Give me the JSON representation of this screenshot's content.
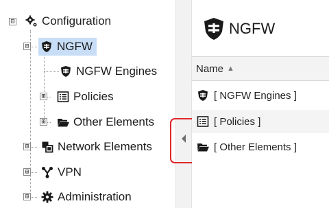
{
  "tree": {
    "root": {
      "label": "Configuration",
      "expander": "⊟",
      "icon": "gear-icon"
    },
    "items": [
      {
        "label": "NGFW",
        "expander": "⊟",
        "icon": "shield-icon",
        "selected": true
      },
      {
        "label": "NGFW Engines",
        "expander": "",
        "icon": "shield-icon"
      },
      {
        "label": "Policies",
        "expander": "⊞",
        "icon": "policy-list-icon"
      },
      {
        "label": "Other Elements",
        "expander": "⊞",
        "icon": "folder-icon"
      },
      {
        "label": "Network Elements",
        "expander": "⊞",
        "icon": "network-elements-icon"
      },
      {
        "label": "VPN",
        "expander": "⊞",
        "icon": "vpn-icon"
      },
      {
        "label": "Administration",
        "expander": "⊞",
        "icon": "gear-icon"
      }
    ]
  },
  "splitter": {
    "collapse_icon": "triangle-left-icon"
  },
  "panel": {
    "title": "NGFW",
    "title_icon": "shield-icon",
    "column": {
      "label": "Name",
      "sort": "▲"
    },
    "rows": [
      {
        "label": "[ NGFW Engines ]",
        "icon": "shield-icon"
      },
      {
        "label": "[ Policies ]",
        "icon": "policy-list-icon"
      },
      {
        "label": "[ Other Elements ]",
        "icon": "folder-icon"
      }
    ]
  },
  "colors": {
    "selection": "#c8def6",
    "highlight_border": "#e0262a",
    "icon": "#1a1a1a"
  }
}
